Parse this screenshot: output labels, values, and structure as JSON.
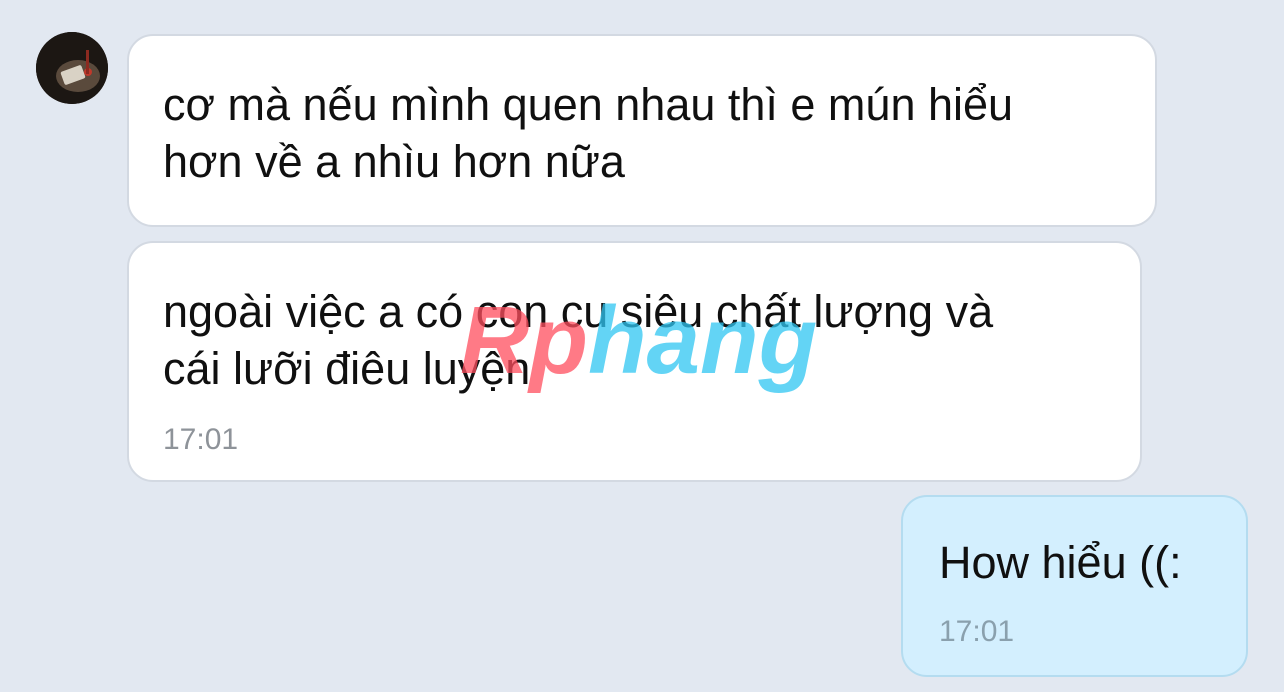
{
  "messages": [
    {
      "sender": "other",
      "lines": [
        "cơ mà nếu mình quen nhau thì e mún hiểu",
        "hơn về a nhìu hơn nữa"
      ],
      "time": ""
    },
    {
      "sender": "other",
      "lines": [
        "ngoài việc a có con cu siêu chất lượng và",
        "cái lưỡi điêu luyện"
      ],
      "time": "17:01"
    },
    {
      "sender": "me",
      "lines": [
        "How hiểu ((:"
      ],
      "time": "17:01"
    }
  ],
  "watermark": "Rphang",
  "colors": {
    "background": "#e2e8f1",
    "incoming_bubble": "#ffffff",
    "outgoing_bubble": "#d3effe",
    "timestamp": "#8e9399"
  }
}
